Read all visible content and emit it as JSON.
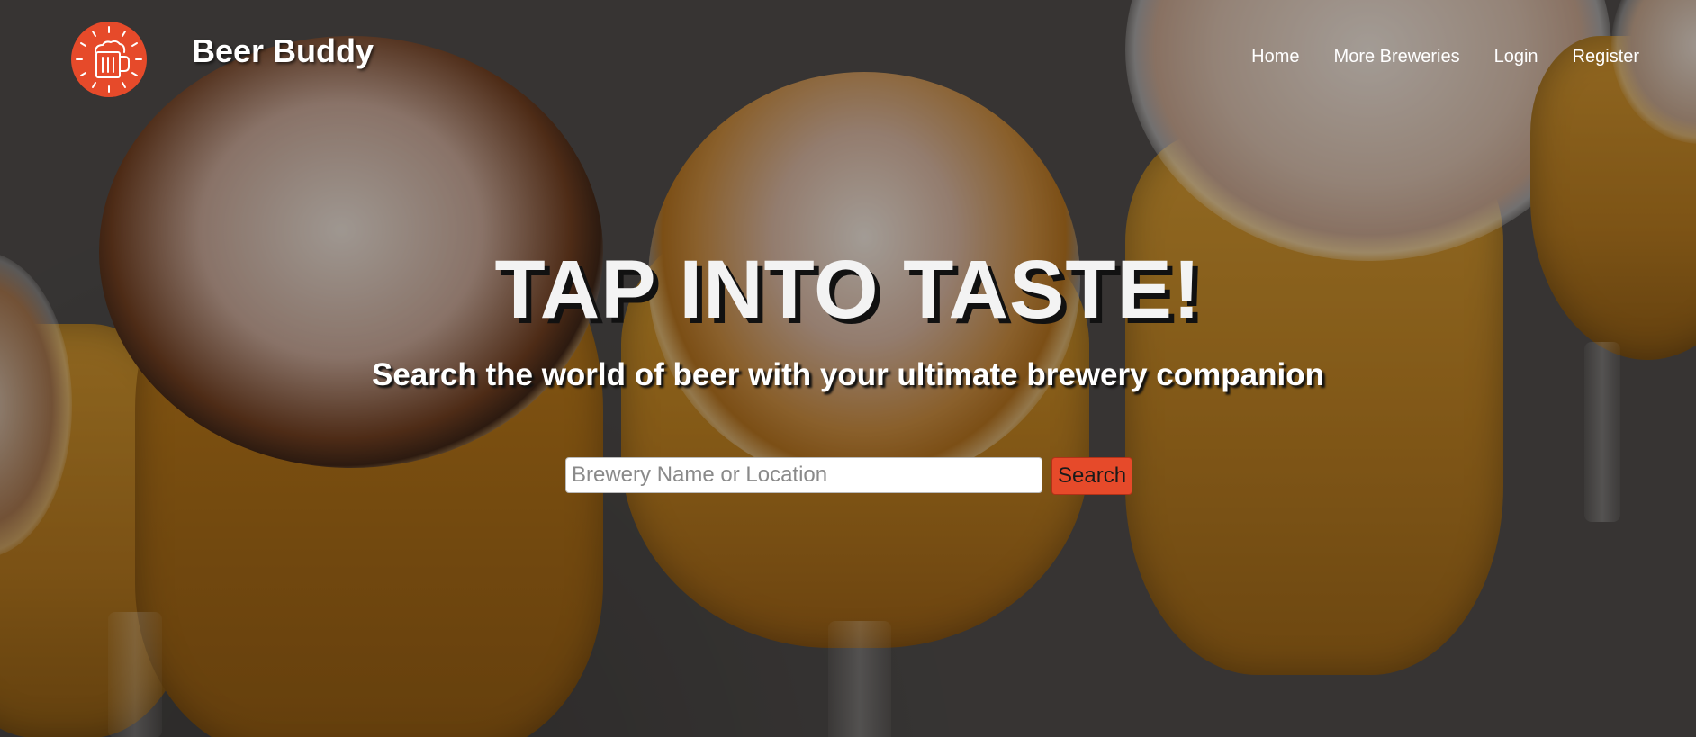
{
  "header": {
    "brand": "Beer Buddy",
    "logo_icon": "beer-mug-icon",
    "nav": [
      {
        "label": "Home"
      },
      {
        "label": "More Breweries"
      },
      {
        "label": "Login"
      },
      {
        "label": "Register"
      }
    ]
  },
  "hero": {
    "headline": "TAP INTO TASTE!",
    "subheadline": "Search the world of beer with your ultimate brewery companion"
  },
  "search": {
    "placeholder": "Brewery Name or Location",
    "value": "",
    "button_label": "Search"
  },
  "colors": {
    "accent": "#e64a2a",
    "text_light": "#ffffff"
  }
}
